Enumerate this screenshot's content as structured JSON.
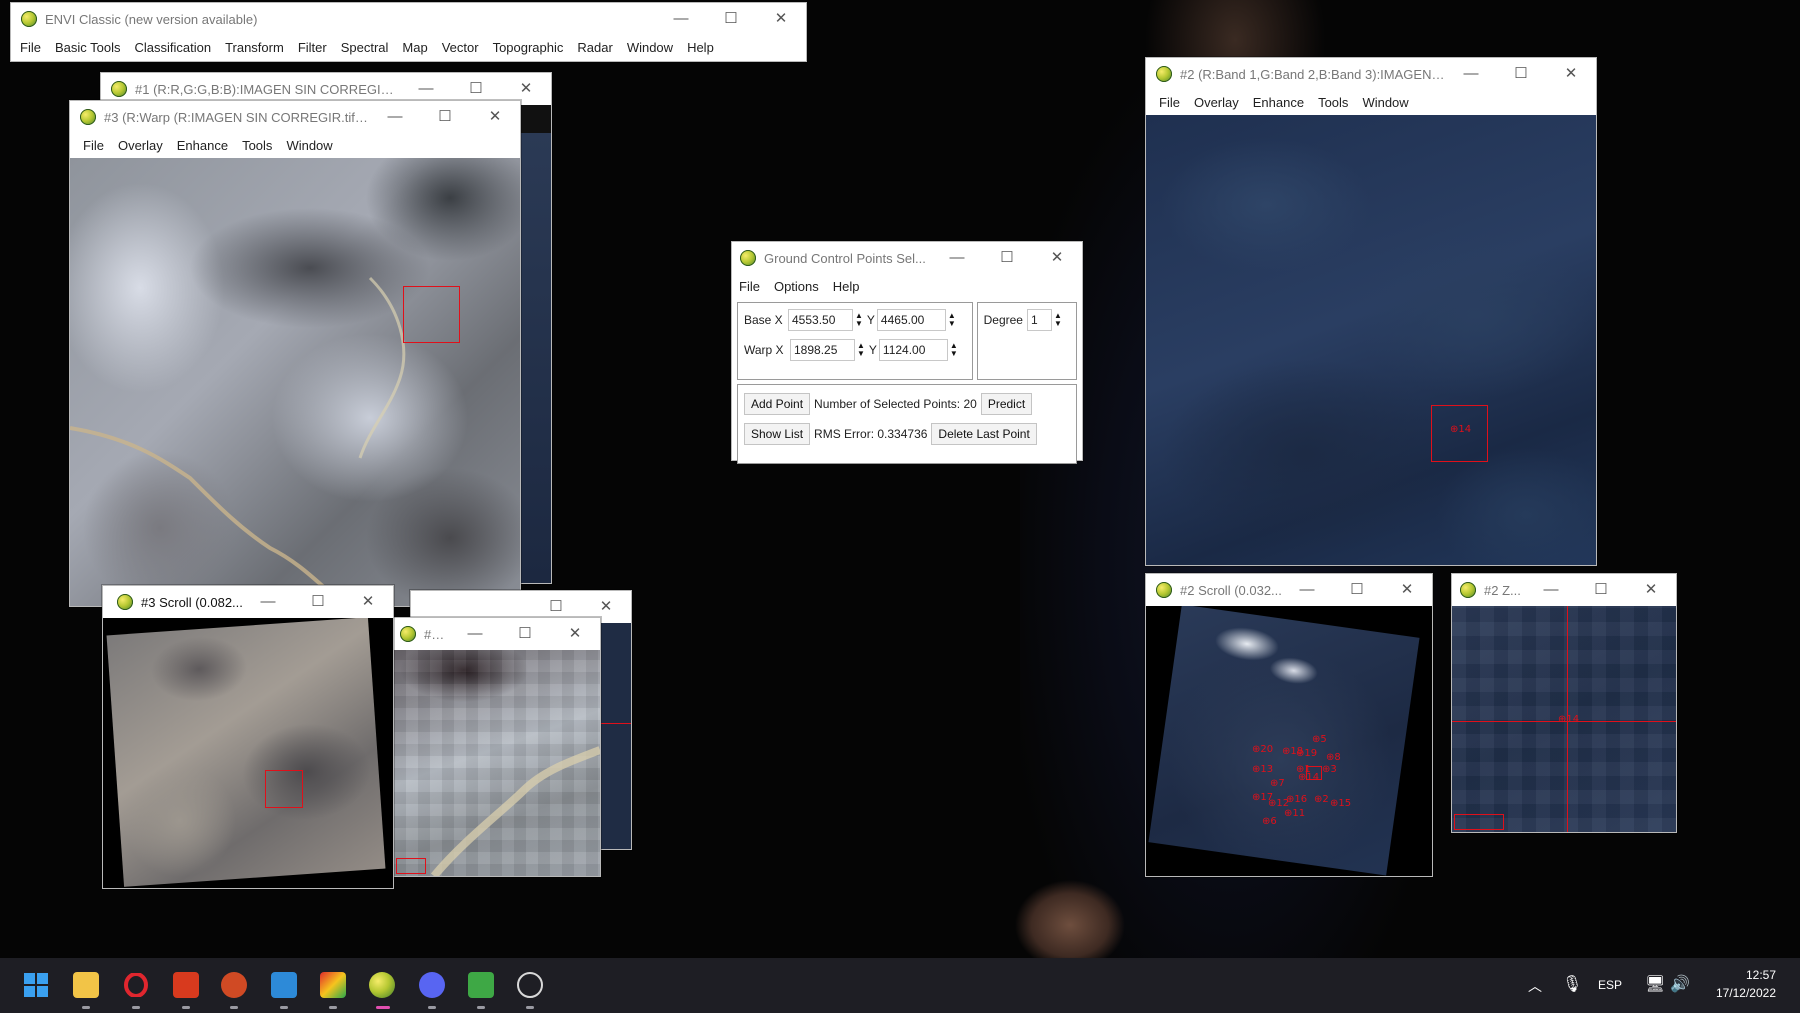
{
  "main_window": {
    "title": "ENVI Classic (new version available)",
    "menu": [
      "File",
      "Basic Tools",
      "Classification",
      "Transform",
      "Filter",
      "Spectral",
      "Map",
      "Vector",
      "Topographic",
      "Radar",
      "Window",
      "Help"
    ]
  },
  "display1": {
    "title": "#1 (R:R,G:G,B:B):IMAGEN SIN CORREGIR.tif"
  },
  "display3": {
    "title": "#3 (R:Warp (R:IMAGEN SIN CORREGIR.tif),...",
    "menu": [
      "File",
      "Overlay",
      "Enhance",
      "Tools",
      "Window"
    ]
  },
  "display2": {
    "title": "#2 (R:Band 1,G:Band 2,B:Band 3):IMAGEN_...",
    "menu": [
      "File",
      "Overlay",
      "Enhance",
      "Tools",
      "Window"
    ],
    "gcp_marker": "⊕14"
  },
  "scroll3": {
    "title": "#3 Scroll (0.082..."
  },
  "zoom3": {
    "title": "#3 Z..."
  },
  "scroll2": {
    "title": "#2 Scroll (0.032..."
  },
  "zoom2": {
    "title": "#2 Z...",
    "gcp_marker": "⊕14"
  },
  "gcp_dialog": {
    "title": "Ground Control Points Sel...",
    "menu": [
      "File",
      "Options",
      "Help"
    ],
    "base_label": "Base X",
    "base_x": "4553.50",
    "y_label": "Y",
    "base_y": "4465.00",
    "warp_label": "Warp X",
    "warp_x": "1898.25",
    "warp_y": "1124.00",
    "degree_label": "Degree",
    "degree": "1",
    "add_point": "Add Point",
    "selected_points": "Number of Selected Points: 20",
    "predict": "Predict",
    "show_list": "Show List",
    "rms_error": "RMS Error: 0.334736",
    "delete_last": "Delete Last Point"
  },
  "scroll2_points": [
    "⊕5",
    "⊕20",
    "⊕18",
    "⊕19",
    "⊕8",
    "⊕13",
    "⊕1",
    "⊕3",
    "⊕7",
    "⊕17",
    "⊕16",
    "⊕2",
    "⊕12",
    "⊕15",
    "⊕11",
    "⊕6",
    "⊕14"
  ],
  "taskbar": {
    "language": "ESP",
    "time": "12:57",
    "date": "17/12/2022"
  },
  "window_controls": {
    "minimize": "—",
    "maximize": "☐",
    "close": "✕"
  },
  "colors": {
    "roi": "#e0101a",
    "taskbar": "#1e1e24"
  }
}
